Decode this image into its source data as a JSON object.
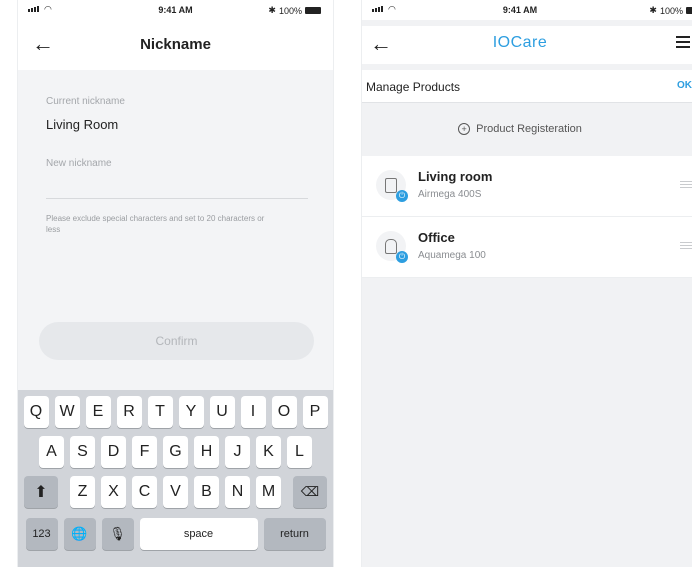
{
  "status_bar": {
    "time": "9:41 AM",
    "battery": "100%"
  },
  "nickname_screen": {
    "title": "Nickname",
    "current_label": "Current nickname",
    "current_value": "Living Room",
    "new_label": "New nickname",
    "helper_text": "Please exclude special characters and set to 20 characters or less",
    "confirm_label": "Confirm"
  },
  "keyboard": {
    "row1": [
      "Q",
      "W",
      "E",
      "R",
      "T",
      "Y",
      "U",
      "I",
      "O",
      "P"
    ],
    "row2": [
      "A",
      "S",
      "D",
      "F",
      "G",
      "H",
      "J",
      "K",
      "L"
    ],
    "row3": [
      "Z",
      "X",
      "C",
      "V",
      "B",
      "N",
      "M"
    ],
    "numbers_label": "123",
    "space_label": "space",
    "return_label": "return"
  },
  "manage_screen": {
    "brand": "IOCare",
    "title": "Manage Products",
    "ok_label": "OK",
    "register_label": "Product Registeration",
    "products": [
      {
        "name": "Living room",
        "model": "Airmega 400S"
      },
      {
        "name": "Office",
        "model": "Aquamega 100"
      }
    ]
  },
  "colors": {
    "accent": "#2d9ee0",
    "background": "#f1f2f4",
    "keyboard": "#d1d4d9"
  }
}
